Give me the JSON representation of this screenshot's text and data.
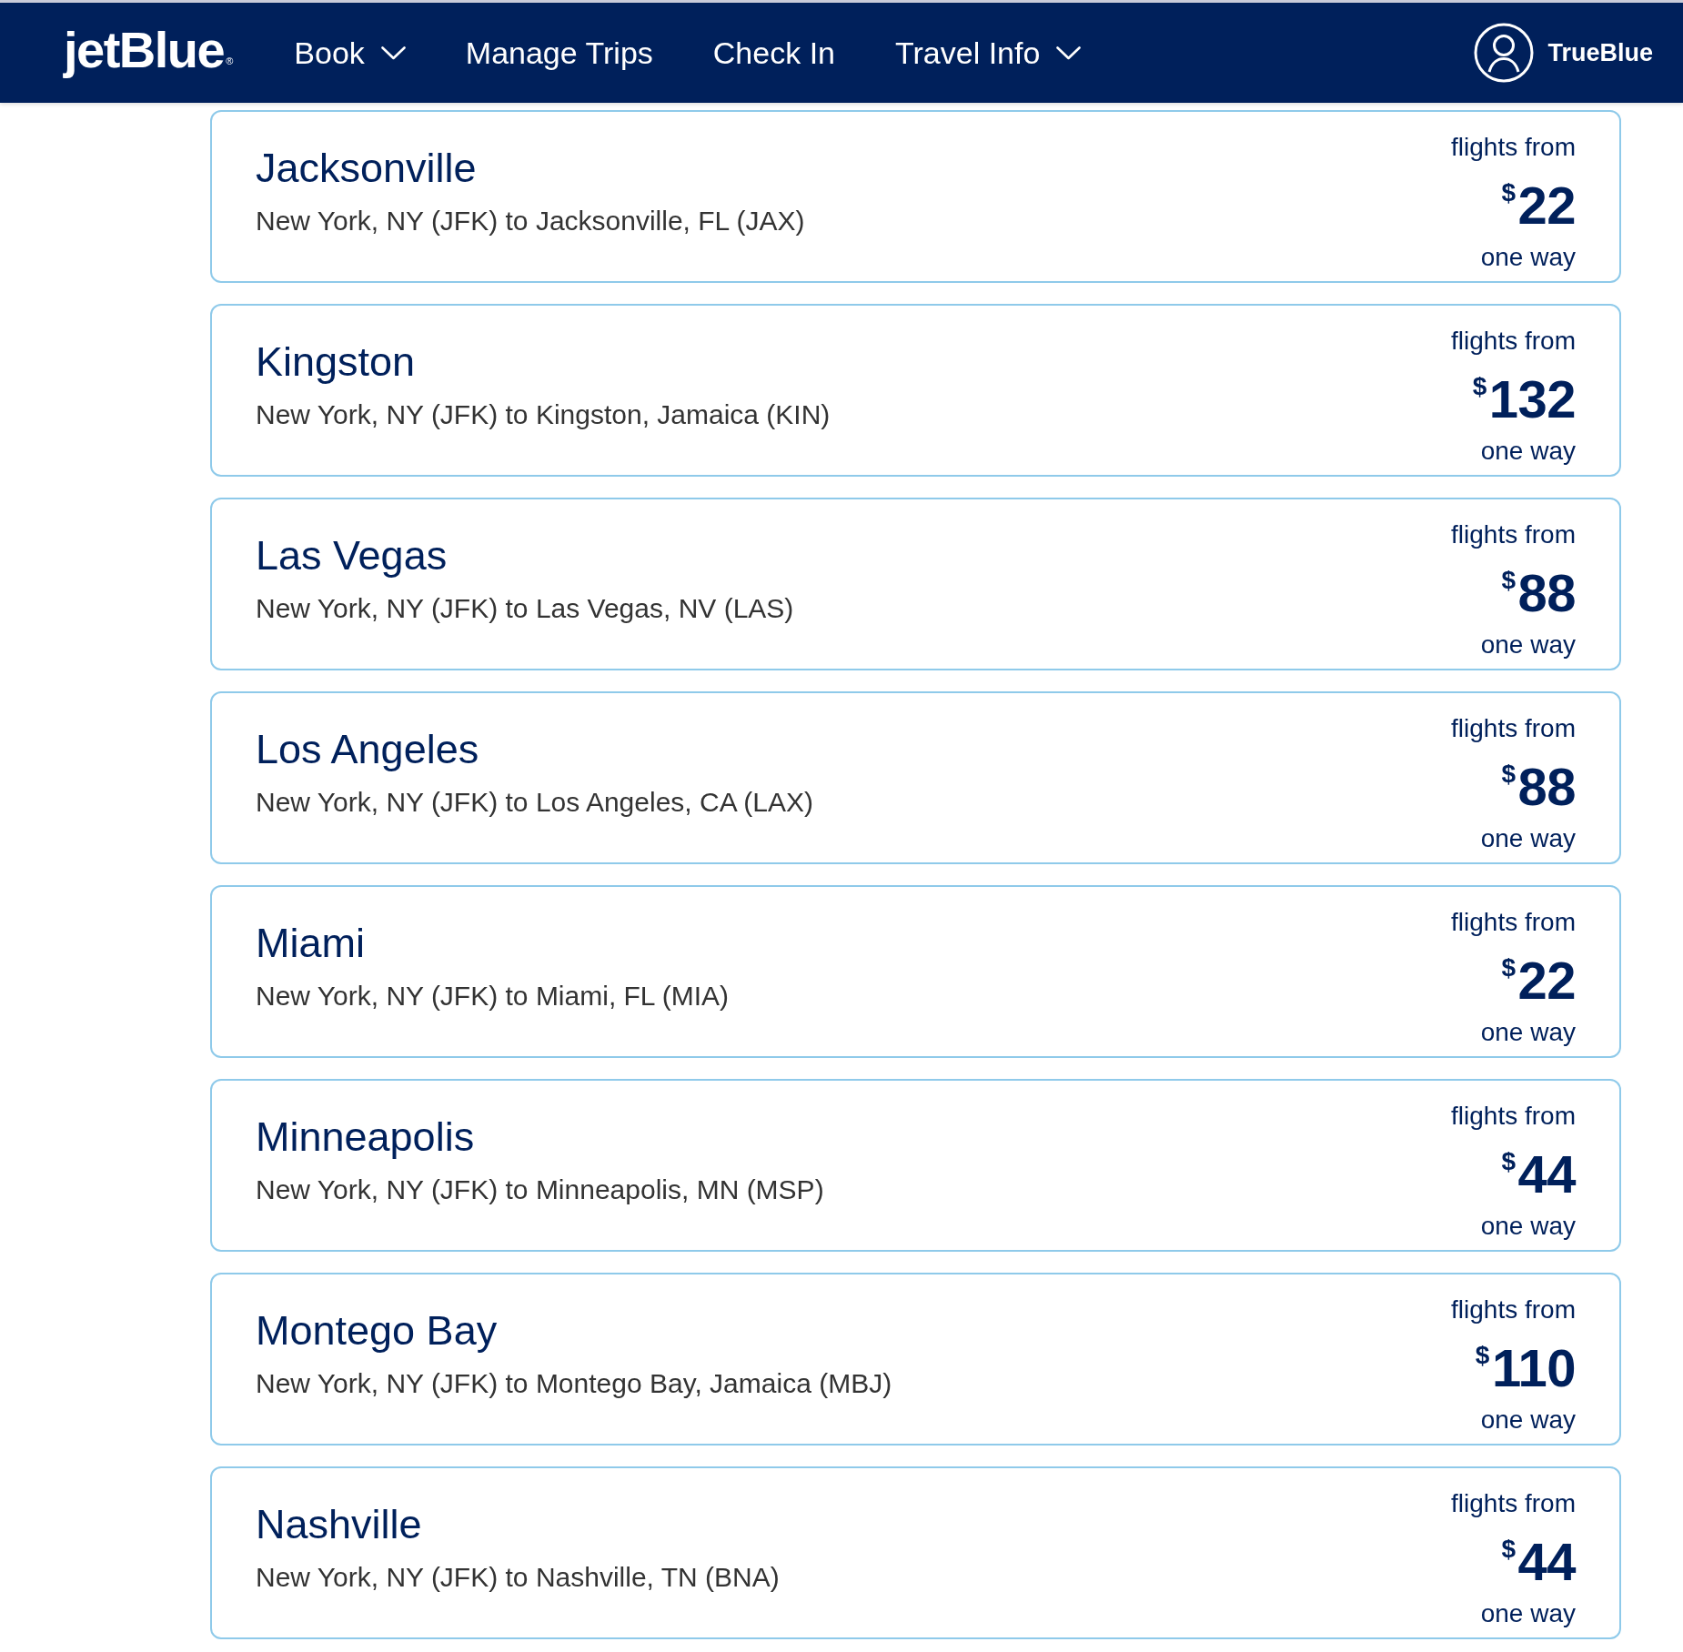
{
  "header": {
    "logo": {
      "text": "jetBlue",
      "mark": "®"
    },
    "nav": [
      {
        "label": "Book",
        "kind": "dropdown"
      },
      {
        "label": "Manage Trips",
        "kind": "link"
      },
      {
        "label": "Check In",
        "kind": "link"
      },
      {
        "label": "Travel Info",
        "kind": "dropdown"
      }
    ],
    "account": {
      "label": "TrueBlue"
    }
  },
  "destinations": [
    {
      "city": "Jacksonville",
      "route": "New York, NY (JFK) to Jacksonville, FL (JAX)",
      "lead": "flights from",
      "currency": "$",
      "amount": "22",
      "trip": "one way"
    },
    {
      "city": "Kingston",
      "route": "New York, NY (JFK) to Kingston, Jamaica (KIN)",
      "lead": "flights from",
      "currency": "$",
      "amount": "132",
      "trip": "one way"
    },
    {
      "city": "Las Vegas",
      "route": "New York, NY (JFK) to Las Vegas, NV (LAS)",
      "lead": "flights from",
      "currency": "$",
      "amount": "88",
      "trip": "one way"
    },
    {
      "city": "Los Angeles",
      "route": "New York, NY (JFK) to Los Angeles, CA (LAX)",
      "lead": "flights from",
      "currency": "$",
      "amount": "88",
      "trip": "one way"
    },
    {
      "city": "Miami",
      "route": "New York, NY (JFK) to Miami, FL (MIA)",
      "lead": "flights from",
      "currency": "$",
      "amount": "22",
      "trip": "one way"
    },
    {
      "city": "Minneapolis",
      "route": "New York, NY (JFK) to Minneapolis, MN (MSP)",
      "lead": "flights from",
      "currency": "$",
      "amount": "44",
      "trip": "one way"
    },
    {
      "city": "Montego Bay",
      "route": "New York, NY (JFK) to Montego Bay, Jamaica (MBJ)",
      "lead": "flights from",
      "currency": "$",
      "amount": "110",
      "trip": "one way"
    },
    {
      "city": "Nashville",
      "route": "New York, NY (JFK) to Nashville, TN (BNA)",
      "lead": "flights from",
      "currency": "$",
      "amount": "44",
      "trip": "one way"
    }
  ]
}
